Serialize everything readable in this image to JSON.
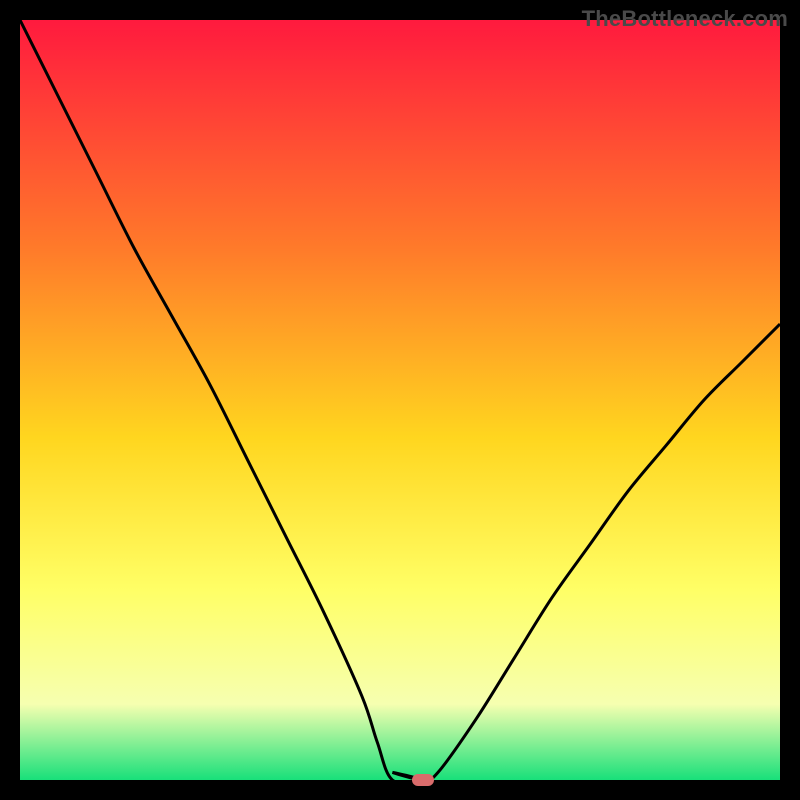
{
  "watermark": "TheBottleneck.com",
  "colors": {
    "frame": "#000000",
    "curve": "#000000",
    "marker": "#d96b6b",
    "gradient_top": "#ff1a3e",
    "gradient_mid1": "#ff7a2a",
    "gradient_mid2": "#ffd61f",
    "gradient_mid3": "#ffff66",
    "gradient_mid4": "#f6ffb0",
    "gradient_bottom": "#18e07a"
  },
  "chart_data": {
    "type": "line",
    "title": "",
    "xlabel": "",
    "ylabel": "",
    "xlim": [
      0,
      100
    ],
    "ylim": [
      0,
      100
    ],
    "grid": false,
    "legend": false,
    "annotations": [
      "TheBottleneck.com"
    ],
    "series": [
      {
        "name": "bottleneck-curve",
        "x": [
          0,
          5,
          10,
          15,
          20,
          25,
          30,
          35,
          40,
          45,
          47,
          49,
          51,
          53,
          55,
          60,
          65,
          70,
          75,
          80,
          85,
          90,
          95,
          100
        ],
        "y": [
          100,
          90,
          80,
          70,
          61,
          52,
          42,
          32,
          22,
          11,
          5,
          1,
          0,
          0,
          1,
          8,
          16,
          24,
          31,
          38,
          44,
          50,
          55,
          60
        ]
      }
    ],
    "flat_segment": {
      "x_start": 49,
      "x_end": 53,
      "y": 0
    },
    "marker": {
      "x": 53,
      "y": 0
    },
    "background_gradient": {
      "direction": "vertical",
      "stops": [
        {
          "pos": 0.0,
          "color": "#ff1a3e"
        },
        {
          "pos": 0.3,
          "color": "#ff7a2a"
        },
        {
          "pos": 0.55,
          "color": "#ffd61f"
        },
        {
          "pos": 0.75,
          "color": "#ffff66"
        },
        {
          "pos": 0.9,
          "color": "#f6ffb0"
        },
        {
          "pos": 1.0,
          "color": "#18e07a"
        }
      ]
    }
  }
}
